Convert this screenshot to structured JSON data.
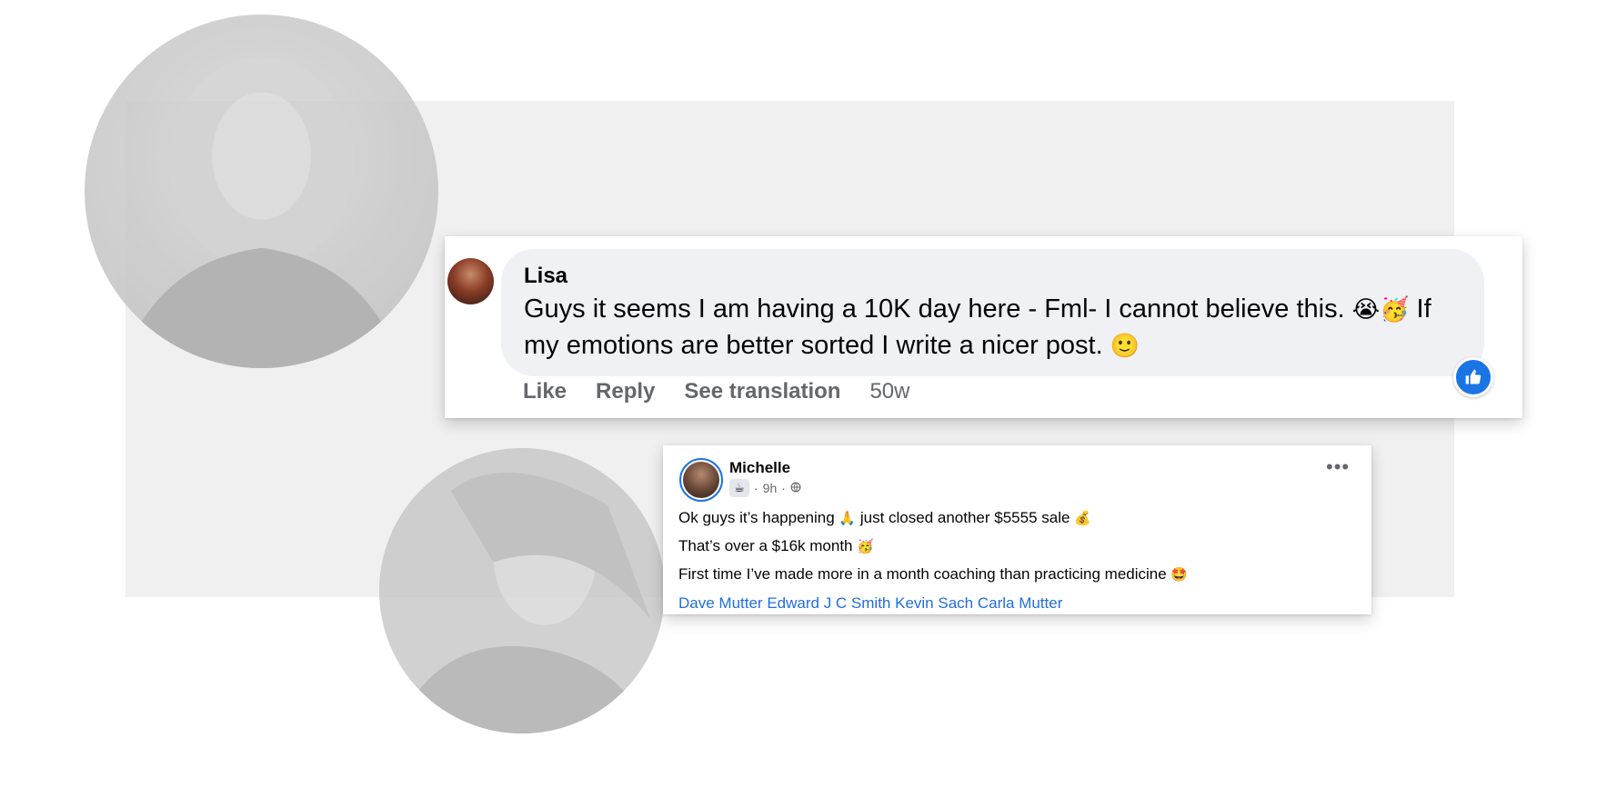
{
  "comment": {
    "author": "Lisa",
    "text_line1": "Guys it seems I am having a 10K day here - Fml- I cannot believe this. ",
    "emoji_1": "😭🥳",
    "text_line1_end": " If",
    "text_line2": "my emotions are better sorted I write a nicer post. ",
    "emoji_2": "🙂",
    "actions": {
      "like": "Like",
      "reply": "Reply",
      "see_translation": "See translation"
    },
    "timestamp": "50w",
    "reaction_icon": "thumbs-up-icon"
  },
  "post": {
    "author": "Michelle",
    "badge_icon": "coffee-cup-icon",
    "badge_glyph": "☕",
    "time": "9h",
    "separator": "·",
    "audience_icon": "globe-icon",
    "more_icon": "more-options-icon",
    "lines": [
      {
        "text": "Ok guys it’s happening ",
        "emoji": "🙏",
        "text2": " just closed another $5555 sale ",
        "emoji2": "💰"
      },
      {
        "text": "That’s over a $16k month ",
        "emoji": "🥳"
      },
      {
        "text": "First time I’ve made more in a month coaching than practicing medicine ",
        "emoji": "🤩"
      }
    ],
    "tags": [
      "Dave Mutter",
      "Edward J C Smith",
      "Kevin Sach",
      "Carla Mutter"
    ]
  },
  "colors": {
    "facebook_blue": "#1b74e4",
    "link_blue": "#216fdb",
    "bubble_gray": "#eff1f4",
    "secondary_text": "#65676b",
    "backdrop_gray": "#f0f0f0"
  }
}
